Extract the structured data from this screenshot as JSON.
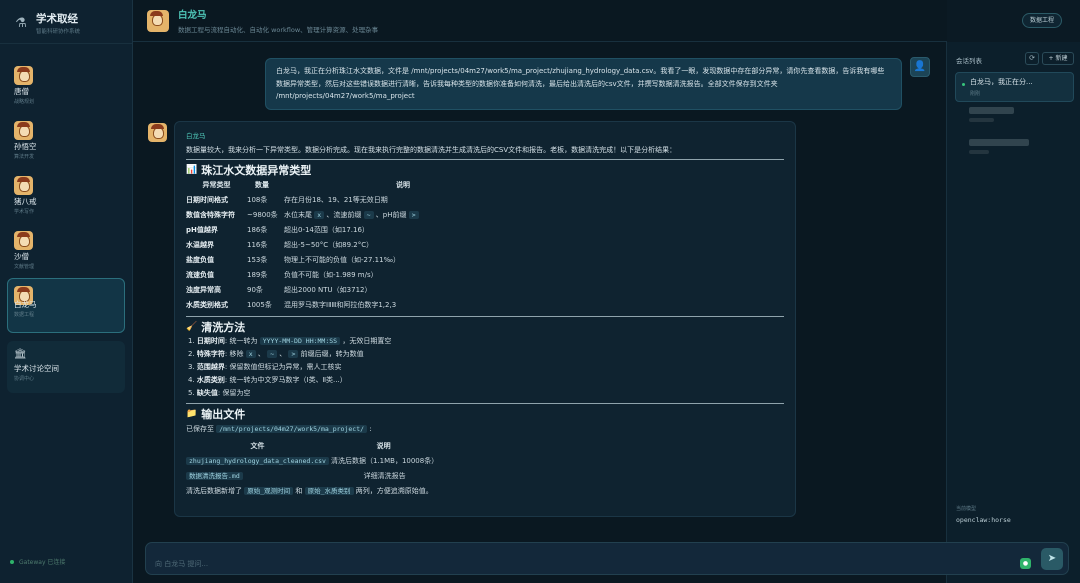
{
  "brand": {
    "title": "学术取经",
    "subtitle": "智能科研协作系统",
    "icon": "flask-icon"
  },
  "agents": [
    {
      "name": "唐僧",
      "role": "战略规划"
    },
    {
      "name": "孙悟空",
      "role": "算法开发"
    },
    {
      "name": "猪八戒",
      "role": "学术写作"
    },
    {
      "name": "沙僧",
      "role": "文献管理"
    },
    {
      "name": "白龙马",
      "role": "数据工程"
    }
  ],
  "forum": {
    "name": "学术讨论空间",
    "subtitle": "协调中心",
    "icon": "building-icon"
  },
  "gateway": {
    "status": "Gateway 已连接"
  },
  "header": {
    "title": "白龙马",
    "subtitle": "数据工程与流程自动化、自动化 workflow、管理计算资源、处理杂事",
    "badge": "数据工程"
  },
  "user_message": "白龙马，我正在分析珠江水文数据，文件是 /mnt/projects/04m27/work5/ma_project/zhujiang_hydrology_data.csv。我看了一眼，发现数据中存在部分异常，请你先查看数据，告诉我有哪些数据异常类型，然后对这些错误数据进行清晰，告诉我每种类型的数据你准备如何清洗，最后给出清洗后的csv文件，并撰写数据清洗报告。全部文件保存到文件夹 /mnt/projects/04m27/work5/ma_project",
  "bot": {
    "name": "白龙马",
    "intro": "数据量较大，我来分析一下异常类型。数据分析完成。现在我来执行完整的数据清洗并生成清洗后的CSV文件和报告。老板，数据清洗完成！以下是分析结果：",
    "section1": {
      "icon": "📊",
      "title": "珠江水文数据异常类型"
    },
    "anomaly_headers": [
      "异常类型",
      "数量",
      "说明"
    ],
    "anomalies": [
      {
        "type": "日期时间格式",
        "count": "108条",
        "desc": "存在月份18、19、21等无效日期"
      },
      {
        "type": "数值含特殊字符",
        "count": "~9800条",
        "desc_pre": "水位末尾 ",
        "c1": "x",
        "desc_mid1": " 、流速前缀 ",
        "c2": "~",
        "desc_mid2": " 、pH前缀 ",
        "c3": ">"
      },
      {
        "type": "pH值越界",
        "count": "186条",
        "desc": "超出0-14范围（如17.16）"
      },
      {
        "type": "水温越界",
        "count": "116条",
        "desc": "超出-5~50°C（如89.2°C）"
      },
      {
        "type": "盐度负值",
        "count": "153条",
        "desc": "物理上不可能的负值（如-27.11‰）"
      },
      {
        "type": "流速负值",
        "count": "189条",
        "desc": "负值不可能（如-1.989 m/s）"
      },
      {
        "type": "浊度异常高",
        "count": "90条",
        "desc": "超出2000 NTU（如3712）"
      },
      {
        "type": "水质类别格式",
        "count": "1005条",
        "desc": "混用罗马数字ⅠⅡⅢ和阿拉伯数字1,2,3"
      }
    ],
    "section2": {
      "icon": "🧹",
      "title": "清洗方法"
    },
    "steps": [
      {
        "n": "1.",
        "label": "日期时间",
        "pre": ": 统一转为 ",
        "code": "YYYY-MM-DD HH:MM:SS",
        "post": " ，无效日期置空"
      },
      {
        "n": "2.",
        "label": "特殊字符",
        "pre": ": 移除 ",
        "c1": "x",
        "c2": "~",
        "c3": ">",
        "post": " 前缀后缀，转为数值"
      },
      {
        "n": "3.",
        "label": "范围越界",
        "pre": ": 保留数值但标记为异常，需人工核实"
      },
      {
        "n": "4.",
        "label": "水质类别",
        "pre": ": 统一转为中文罗马数字（Ⅰ类、Ⅱ类...）"
      },
      {
        "n": "5.",
        "label": "缺失值",
        "pre": ": 保留为空"
      }
    ],
    "section3": {
      "icon": "📁",
      "title": "输出文件"
    },
    "saved_pre": "已保存至 ",
    "saved_path": "/mnt/projects/04m27/work5/ma_project/",
    "saved_post": " :",
    "file_headers": [
      "文件",
      "说明"
    ],
    "files": [
      {
        "name": "zhujiang_hydrology_data_cleaned.csv",
        "desc": "清洗后数据（1.1MB，10008条）"
      },
      {
        "name": "数据清洗报告.md",
        "desc": "详细清洗报告"
      }
    ],
    "closing_pre": "清洗后数据新增了 ",
    "closing_c1": "原始_观测时间",
    "closing_mid": " 和 ",
    "closing_c2": "原始_水质类别",
    "closing_post": " 两列，方便追溯原始值。"
  },
  "sessions": {
    "title": "会话列表",
    "refresh": "⟳",
    "new": "+ 新建",
    "items": [
      {
        "title": "白龙马，我正在分...",
        "time": "刚刚"
      }
    ]
  },
  "model": {
    "label": "当前模型",
    "value": "openclaw:horse"
  },
  "composer": {
    "placeholder": "向 白龙马 提问..."
  }
}
